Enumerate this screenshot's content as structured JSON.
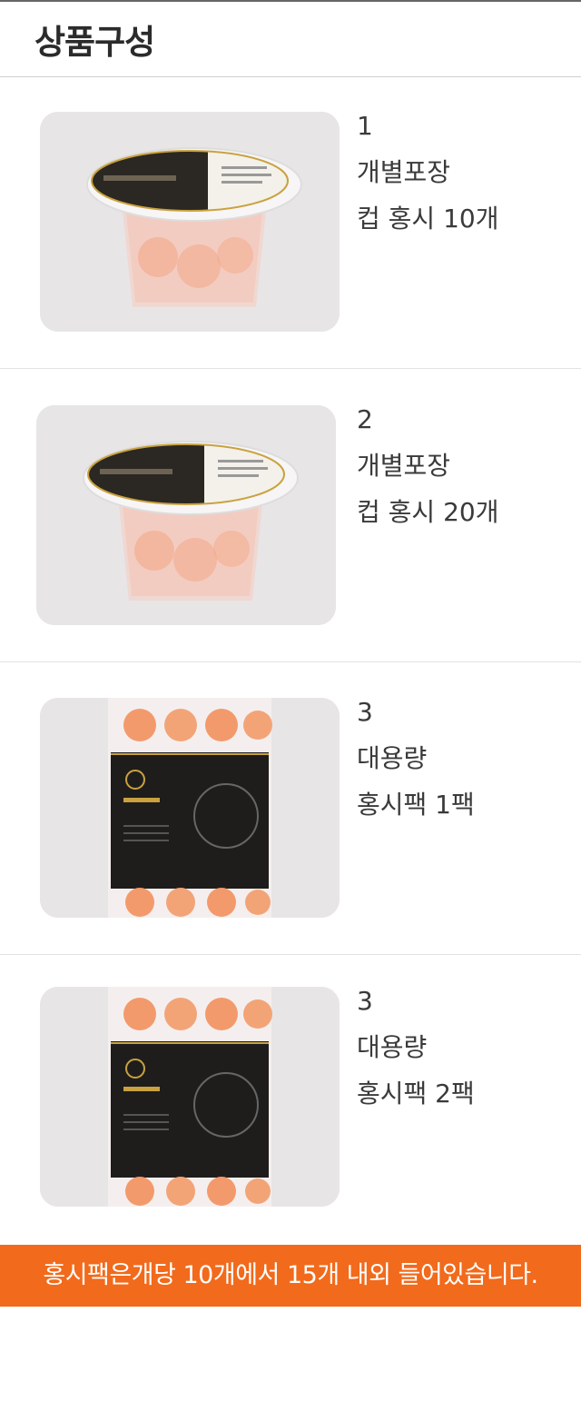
{
  "header": {
    "title": "상품구성"
  },
  "items": [
    {
      "number": "1",
      "line1": "개별포장",
      "line2": "컵 홍시 10개",
      "image": "cup-hongsi-photo"
    },
    {
      "number": "2",
      "line1": "개별포장",
      "line2": "컵 홍시 20개",
      "image": "cup-hongsi-photo"
    },
    {
      "number": "3",
      "line1": "대용량",
      "line2": "홍시팩 1팩",
      "image": "hongsi-pack-photo"
    },
    {
      "number": "3",
      "line1": "대용량",
      "line2": "홍시팩 2팩",
      "image": "hongsi-pack-photo"
    }
  ],
  "banner": {
    "text": "홍시팩은개당 10개에서 15개 내외 들어있습니다."
  },
  "colors": {
    "accent": "#f26a1b",
    "photo_bg": "#e8e5e7",
    "lid": "#2b2722",
    "gold": "#c9a23f"
  }
}
